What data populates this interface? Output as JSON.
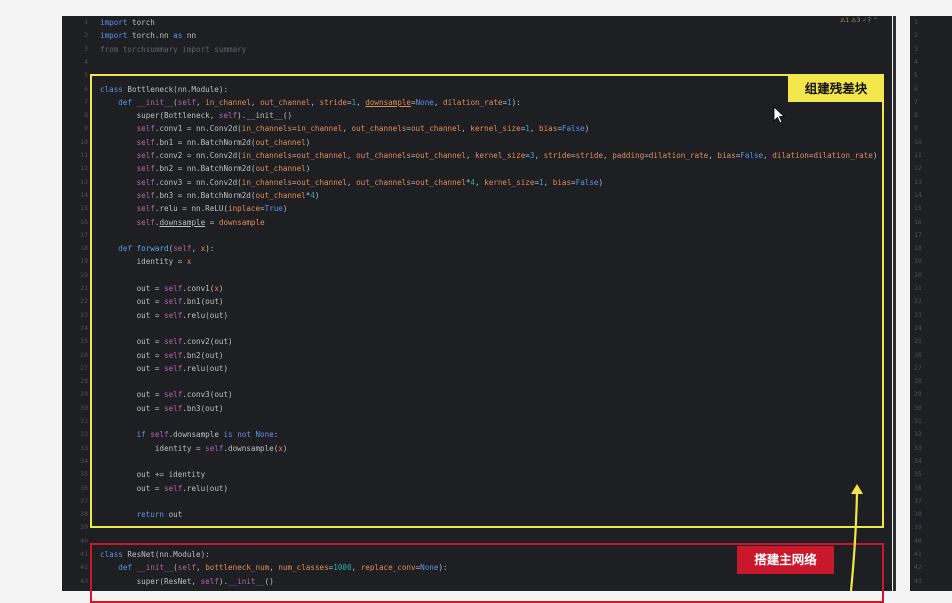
{
  "status": {
    "warnings": "1",
    "weak_warnings": "3",
    "ok": "7"
  },
  "annotations": {
    "yellow_label": "组建残差块",
    "red_label": "搭建主网络"
  },
  "line_numbers": [
    "1",
    "2",
    "3",
    "4",
    "5",
    "6",
    "7",
    "8",
    "9",
    "10",
    "11",
    "12",
    "13",
    "14",
    "15",
    "16",
    "17",
    "18",
    "19",
    "20",
    "21",
    "22",
    "23",
    "24",
    "25",
    "26",
    "27",
    "28",
    "29",
    "30",
    "31",
    "32",
    "33",
    "34",
    "35",
    "36",
    "37",
    "38",
    "39",
    "40",
    "41",
    "42",
    "43"
  ],
  "right_line_numbers": [
    "1",
    "2",
    "3",
    "4",
    "5",
    "6",
    "7",
    "8",
    "9",
    "10",
    "11",
    "12",
    "13",
    "14",
    "15",
    "16",
    "17",
    "18",
    "19",
    "20",
    "21",
    "22",
    "23",
    "24",
    "25",
    "26",
    "27",
    "28",
    "29",
    "30",
    "31",
    "32",
    "33",
    "34",
    "35",
    "36",
    "37",
    "38",
    "39",
    "40",
    "41",
    "42",
    "43"
  ],
  "colors": {
    "yellow": "#f2e64a",
    "red": "#c9172b",
    "editor_bg": "#1e1f22"
  }
}
